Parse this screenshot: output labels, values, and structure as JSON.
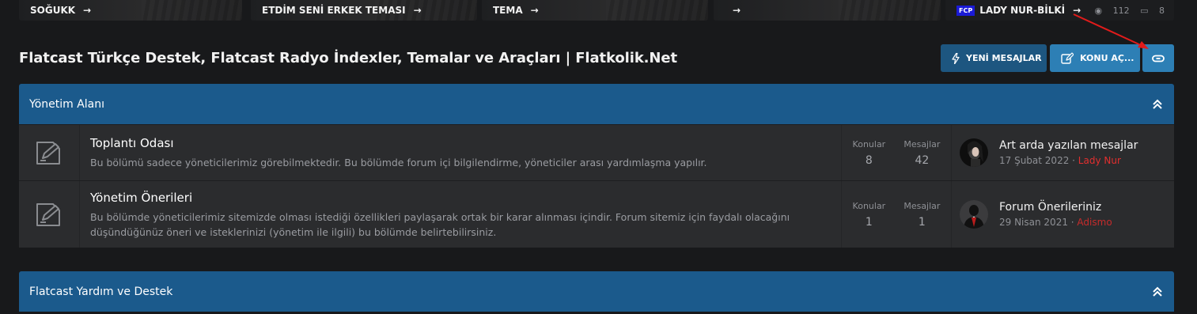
{
  "slider": [
    {
      "text": "SOĞUKK",
      "arrow": "→"
    },
    {
      "text": "ETDİM SENİ ERKEK TEMASI",
      "arrow": "→"
    },
    {
      "text": "TEMA",
      "arrow": "→"
    },
    {
      "text": "",
      "arrow": "→"
    },
    {
      "badge": "FCP",
      "text": "LADY NUR-BİLKİ",
      "arrow": "→",
      "views": "112",
      "replies": "8"
    }
  ],
  "header": {
    "title": "Flatcast Türkçe Destek, Flatcast Radyo İndexler, Temalar ve Araçları | Flatkolik.Net",
    "new_posts": "YENİ MESAJLAR",
    "post_thread": "KONU AÇ..."
  },
  "colors": {
    "category_header": "#1b5a8c",
    "button_dark": "#1d5680",
    "button_light": "#2d7fb5",
    "username_red": "#e22f2f"
  },
  "categories": [
    {
      "title": "Yönetim Alanı",
      "nodes": [
        {
          "icon": "forum-node-icon",
          "title": "Toplantı Odası",
          "description": "Bu bölümü sadece yöneticilerimiz görebilmektedir. Bu bölümde forum içi bilgilendirme, yöneticiler arası yardımlaşma yapılır.",
          "threads_label": "Konular",
          "threads": "8",
          "messages_label": "Mesajlar",
          "messages": "42",
          "last_title": "Art arda yazılan mesajlar",
          "last_date": "17 Şubat 2022",
          "separator": " · ",
          "last_user": "Lady Nur"
        },
        {
          "icon": "forum-node-icon",
          "title": "Yönetim Önerileri",
          "description": "Bu bölümde yöneticilerimiz sitemizde olması istediği özellikleri paylaşarak ortak bir karar alınması içindir. Forum sitemiz için faydalı olacağını düşündüğünüz öneri ve isteklerinizi (yönetim ile ilgili) bu bölümde belirtebilirsiniz.",
          "threads_label": "Konular",
          "threads": "1",
          "messages_label": "Mesajlar",
          "messages": "1",
          "last_title": "Forum Önerileriniz",
          "last_date": "29 Nisan 2021",
          "separator": " · ",
          "last_user": "Adismo"
        }
      ]
    },
    {
      "title": "Flatcast Yardım ve Destek"
    }
  ]
}
